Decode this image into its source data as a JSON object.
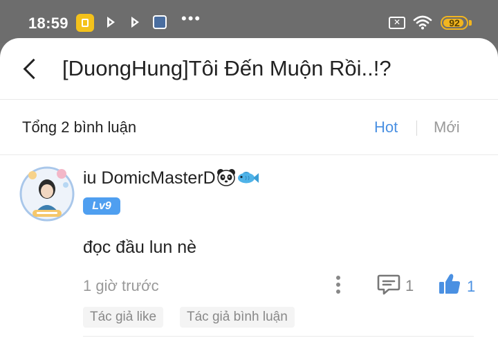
{
  "status_bar": {
    "time": "18:59",
    "battery": "92",
    "battery_level": 0.92,
    "icons": [
      "app-notification-icon",
      "play-icon",
      "play-icon",
      "image-icon",
      "more-dots-icon",
      "sim-off-icon",
      "wifi-icon",
      "battery-icon"
    ],
    "more_dots": "•••",
    "sim_mark": "✕"
  },
  "header": {
    "title": "[DuongHung]Tôi Đến Muộn Rồi..!?"
  },
  "comments_bar": {
    "count_label": "Tổng 2 bình luận",
    "sort_hot": "Hot",
    "sort_new": "Mới",
    "accent_color": "#4a90e2"
  },
  "comment": {
    "username": "iu DomicMasterD",
    "username_emojis": [
      "panda-emoji-icon",
      "fish-emoji-icon"
    ],
    "level": "Lv9",
    "text": "đọc đầu lun nè",
    "time": "1 giờ trước",
    "reply_count": "1",
    "like_count": "1",
    "tags": [
      "Tác giả like",
      "Tác giả bình luận"
    ]
  }
}
